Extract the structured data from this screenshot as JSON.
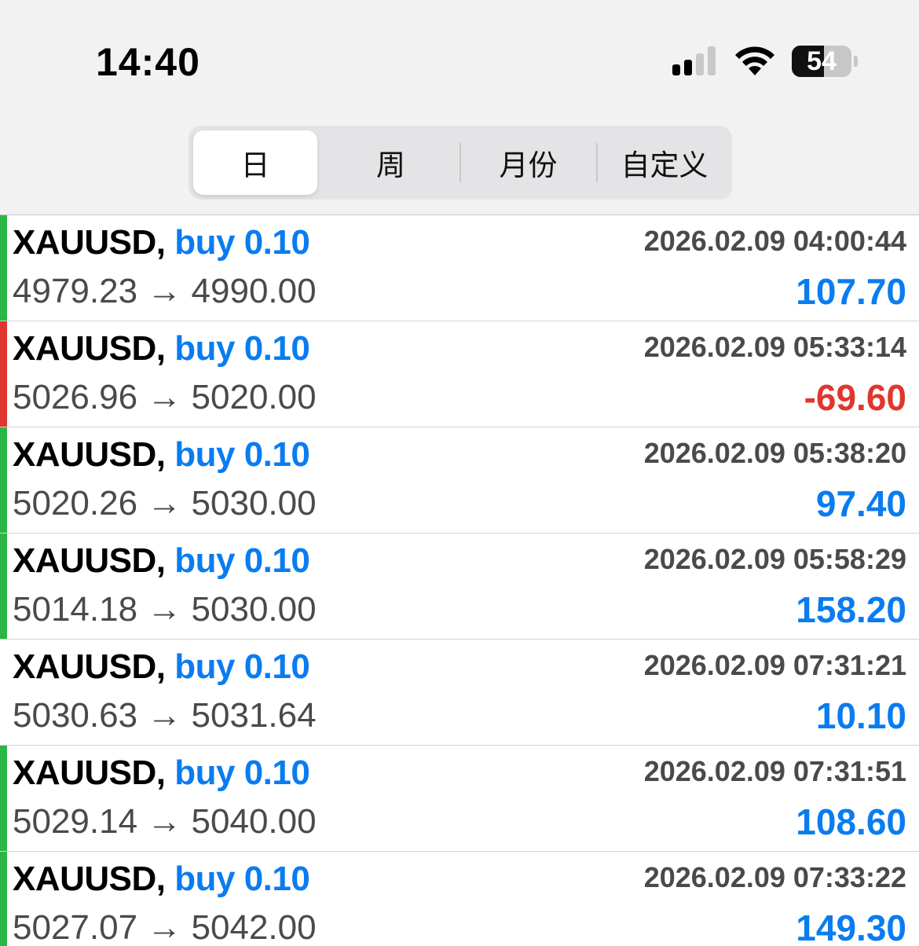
{
  "status_bar": {
    "time": "14:40",
    "battery_percent": "54",
    "battery_level": 0.54,
    "signal_bars_active": 2,
    "signal_bars_total": 4
  },
  "period_tabs": {
    "items": [
      "日",
      "周",
      "月份",
      "自定义"
    ],
    "selected_index": 0
  },
  "colors": {
    "buy_blue": "#0a7cf0",
    "profit_blue": "#0a7cf0",
    "loss_red": "#e0362d",
    "gain_green": "#2bb544",
    "text_gray": "#4a4a4a"
  },
  "trades": [
    {
      "symbol": "XAUUSD,",
      "side_volume": "buy 0.10",
      "prices": {
        "open": "4979.23",
        "arrow": "→",
        "close": "4990.00"
      },
      "time": "2026.02.09 04:00:44",
      "profit": "107.70",
      "result": "win"
    },
    {
      "symbol": "XAUUSD,",
      "side_volume": "buy 0.10",
      "prices": {
        "open": "5026.96",
        "arrow": "→",
        "close": "5020.00"
      },
      "time": "2026.02.09 05:33:14",
      "profit": "-69.60",
      "result": "loss"
    },
    {
      "symbol": "XAUUSD,",
      "side_volume": "buy 0.10",
      "prices": {
        "open": "5020.26",
        "arrow": "→",
        "close": "5030.00"
      },
      "time": "2026.02.09 05:38:20",
      "profit": "97.40",
      "result": "win"
    },
    {
      "symbol": "XAUUSD,",
      "side_volume": "buy 0.10",
      "prices": {
        "open": "5014.18",
        "arrow": "→",
        "close": "5030.00"
      },
      "time": "2026.02.09 05:58:29",
      "profit": "158.20",
      "result": "win"
    },
    {
      "symbol": "XAUUSD,",
      "side_volume": "buy 0.10",
      "prices": {
        "open": "5030.63",
        "arrow": "→",
        "close": "5031.64"
      },
      "time": "2026.02.09 07:31:21",
      "profit": "10.10",
      "result": "none"
    },
    {
      "symbol": "XAUUSD,",
      "side_volume": "buy 0.10",
      "prices": {
        "open": "5029.14",
        "arrow": "→",
        "close": "5040.00"
      },
      "time": "2026.02.09 07:31:51",
      "profit": "108.60",
      "result": "win"
    },
    {
      "symbol": "XAUUSD,",
      "side_volume": "buy 0.10",
      "prices": {
        "open": "5027.07",
        "arrow": "→",
        "close": "5042.00"
      },
      "time": "2026.02.09 07:33:22",
      "profit": "149.30",
      "result": "win"
    }
  ]
}
